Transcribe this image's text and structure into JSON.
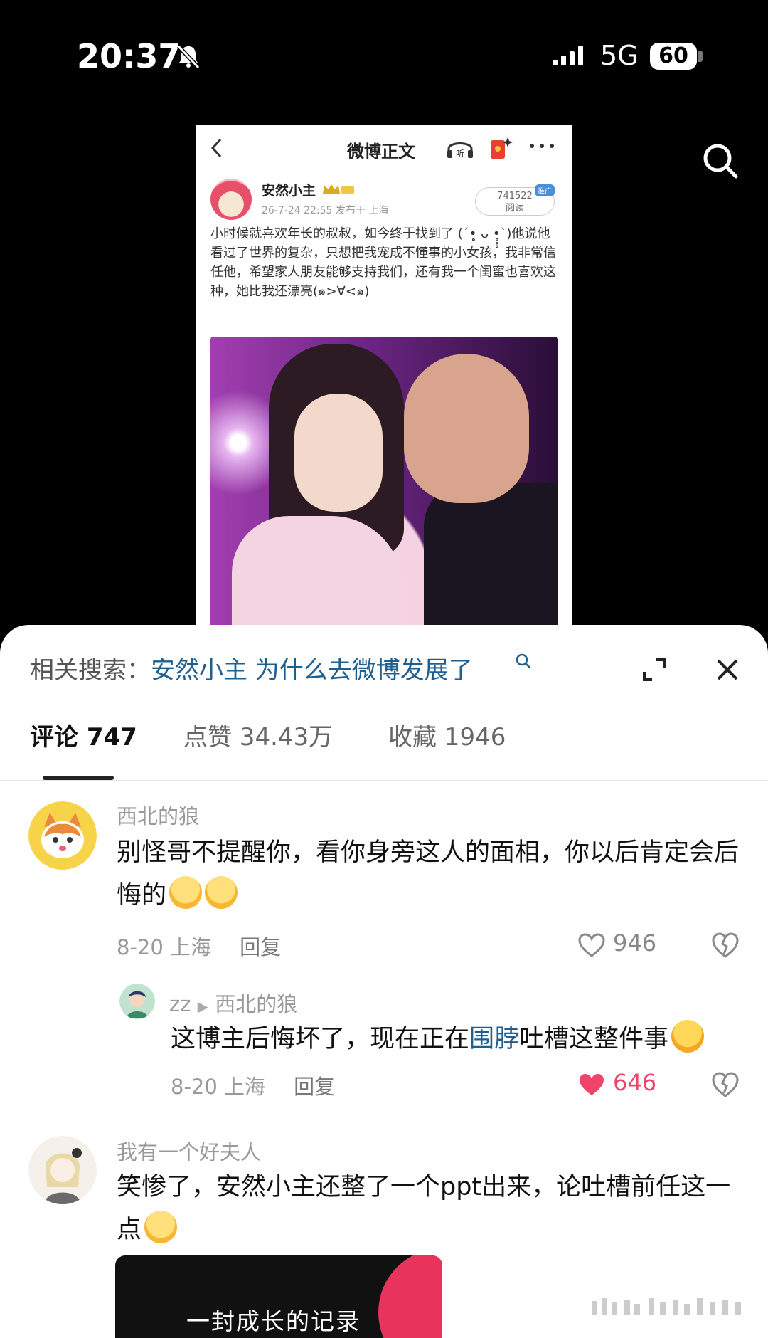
{
  "status_bar": {
    "time": "20:37",
    "network": "5G",
    "battery": "60"
  },
  "post": {
    "nav_title": "微博正文",
    "listen_label": "听",
    "author_name": "安然小主",
    "meta": "26-7-24 22:55  发布于 上海",
    "read_count": "741522",
    "read_label": "阅读",
    "promo_tag": "推广",
    "text": "小时候就喜欢年长的叔叔，如今终于找到了 (´•̥̥̥ ᴗ •̥̥̥`)他说他看过了世界的复杂，只想把我宠成不懂事的小女孩，我非常信任他，希望家人朋友能够支持我们，还有我一个闺蜜也喜欢这种，她比我还漂亮(๑>∀<๑)"
  },
  "sheet": {
    "related_prefix": "相关搜索：",
    "related_query": "安然小主 为什么去微博发展了",
    "tabs": [
      {
        "label": "评论 747"
      },
      {
        "label": "点赞 34.43万"
      },
      {
        "label": "收藏 1946"
      }
    ]
  },
  "comments": [
    {
      "name": "西北的狼",
      "text": "别怪哥不提醒你，看你身旁这人的面相，你以后肯定会后悔的",
      "date": "8-20",
      "location": "上海",
      "reply": "回复",
      "likes": "946"
    },
    {
      "name": "zz",
      "reply_to": "西北的狼",
      "text_before": "这博主后悔坏了，现在正在",
      "text_link": "围脖",
      "text_after": "吐槽这整件事",
      "date": "8-20",
      "location": "上海",
      "reply": "回复",
      "likes": "646"
    },
    {
      "name": "我有一个好夫人",
      "text": "笑惨了，安然小主还整了一个ppt出来，论吐槽前任这一点",
      "card_text": "一封成长的记录"
    }
  ],
  "colors": {
    "link": "#1f5f8f",
    "liked_heart": "#f0446b",
    "card_accent": "#e8345d"
  }
}
